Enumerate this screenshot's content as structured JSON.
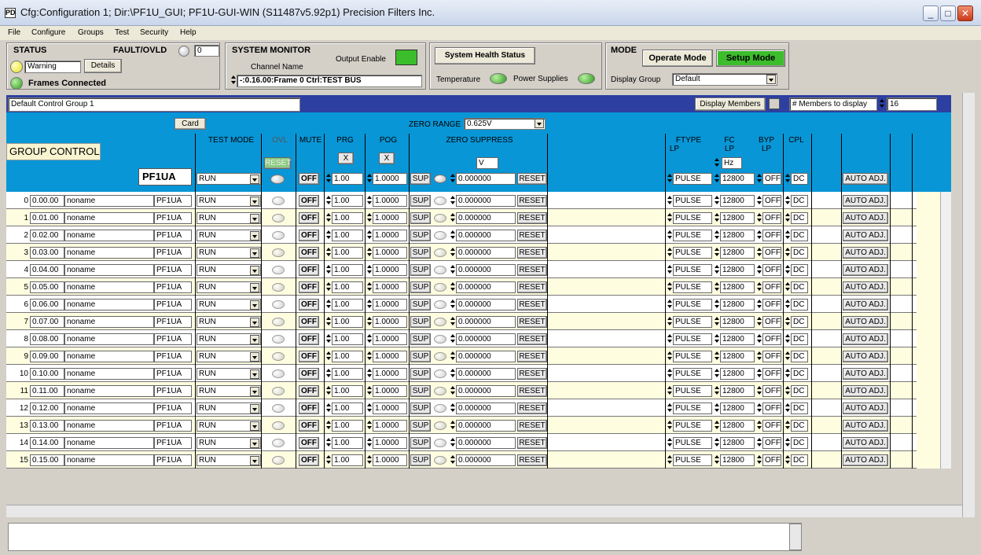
{
  "window": {
    "title": "Cfg:Configuration 1; Dir:\\PF1U_GUI;   PF1U-GUI-WIN (S11487v5.92p1) Precision Filters Inc.",
    "logo": "PD",
    "min": "_",
    "max": "□",
    "close": "✕"
  },
  "menu": [
    "File",
    "Configure",
    "Groups",
    "Test",
    "Security",
    "Help"
  ],
  "status": {
    "title": "STATUS",
    "fault_label": "FAULT/OVLD",
    "fault_value": "0",
    "warning": "Warning",
    "details": "Details",
    "frames": "Frames Connected"
  },
  "sysmon": {
    "title": "SYSTEM MONITOR",
    "channel_label": "Channel Name",
    "output_enable": "Output Enable",
    "channel_value": "-:0.16.00:Frame 0 Ctrl:TEST BUS"
  },
  "health": {
    "button": "System Health Status",
    "temperature": "Temperature",
    "power": "Power Supplies"
  },
  "mode": {
    "title": "MODE",
    "operate": "Operate Mode",
    "setup": "Setup Mode",
    "display_group_label": "Display Group",
    "display_group_value": "Default"
  },
  "group": {
    "name": "Default Control Group 1",
    "display_members": "Display Members",
    "members_label": "# Members to display",
    "members_value": "16"
  },
  "header": {
    "card": "Card",
    "zero_range_label": "ZERO RANGE",
    "zero_range_value": "0.625V",
    "group_control": "GROUP CONTROL",
    "pf1ua": "PF1UA",
    "test_mode": "TEST MODE",
    "ovl": "OVL",
    "mute": "MUTE",
    "prg": "PRG",
    "pog": "POG",
    "zero_suppress": "ZERO SUPPRESS",
    "ftype": "FTYPE",
    "lp1": "LP",
    "fc": "FC",
    "lp2": "LP",
    "byp": "BYP",
    "lp3": "LP",
    "cpl": "CPL",
    "reset": "RESET",
    "x1": "X",
    "x2": "X",
    "v": "V",
    "hz": "Hz",
    "ctrl": {
      "test": "RUN",
      "mute": "OFF",
      "prg": "1.00",
      "pog": "1.0000",
      "sup": "SUP",
      "zero": "0.000000",
      "reset": "RESET",
      "ftype": "PULSE",
      "fc": "12800",
      "byp": "OFF",
      "cpl": "DC",
      "auto": "AUTO ADJ."
    }
  },
  "channels": [
    {
      "idx": "0",
      "addr": "0.00.00",
      "name": "noname"
    },
    {
      "idx": "1",
      "addr": "0.01.00",
      "name": "noname"
    },
    {
      "idx": "2",
      "addr": "0.02.00",
      "name": "noname"
    },
    {
      "idx": "3",
      "addr": "0.03.00",
      "name": "noname"
    },
    {
      "idx": "4",
      "addr": "0.04.00",
      "name": "noname"
    },
    {
      "idx": "5",
      "addr": "0.05.00",
      "name": "noname"
    },
    {
      "idx": "6",
      "addr": "0.06.00",
      "name": "noname"
    },
    {
      "idx": "7",
      "addr": "0.07.00",
      "name": "noname"
    },
    {
      "idx": "8",
      "addr": "0.08.00",
      "name": "noname"
    },
    {
      "idx": "9",
      "addr": "0.09.00",
      "name": "noname"
    },
    {
      "idx": "10",
      "addr": "0.10.00",
      "name": "noname"
    },
    {
      "idx": "11",
      "addr": "0.11.00",
      "name": "noname"
    },
    {
      "idx": "12",
      "addr": "0.12.00",
      "name": "noname"
    },
    {
      "idx": "13",
      "addr": "0.13.00",
      "name": "noname"
    },
    {
      "idx": "14",
      "addr": "0.14.00",
      "name": "noname"
    },
    {
      "idx": "15",
      "addr": "0.15.00",
      "name": "noname"
    }
  ],
  "row_values": {
    "card": "PF1UA",
    "test": "RUN",
    "mute": "OFF",
    "prg": "1.00",
    "pog": "1.0000",
    "sup": "SUP",
    "zero": "0.000000",
    "reset": "RESET",
    "ftype": "PULSE",
    "fc": "12800",
    "byp": "OFF",
    "cpl": "DC",
    "auto": "AUTO ADJ."
  },
  "colors": {
    "title_blue": "#2d3fa0",
    "header_cyan": "#0996d6",
    "odd_row": "#fffde0",
    "green_btn": "#3cbd2c"
  }
}
